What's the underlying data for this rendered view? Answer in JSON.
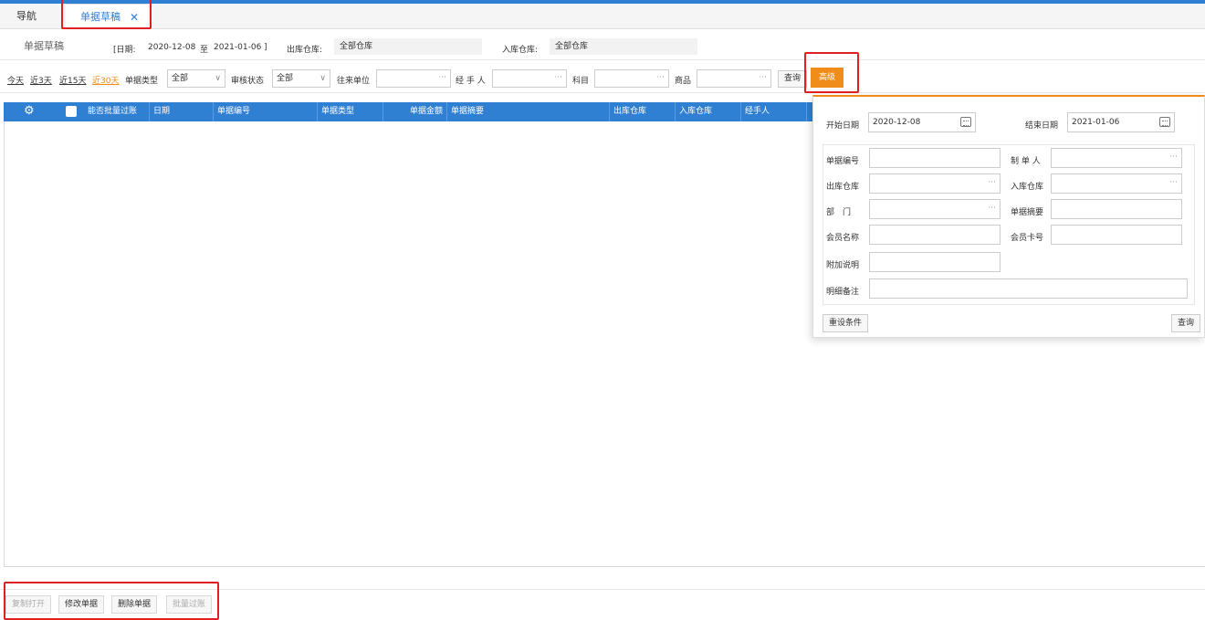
{
  "tabs": {
    "nav_label": "导航",
    "active_label": "单据草稿",
    "close_glyph": "✕"
  },
  "info": {
    "title": "单据草稿",
    "date_label": "[日期:",
    "date_from": "2020-12-08",
    "date_sep": "至",
    "date_to": "2021-01-06",
    "date_end": "]",
    "out_wh_label": "出库仓库:",
    "out_wh_value": "全部仓库",
    "in_wh_label": "入库仓库:",
    "in_wh_value": "全部仓库"
  },
  "filters": {
    "today": "今天",
    "last3": "近3天",
    "last15": "近15天",
    "last30": "近30天",
    "doc_type_label": "单据类型",
    "doc_type_value": "全部",
    "audit_label": "审核状态",
    "audit_value": "全部",
    "partner_label": "往来单位",
    "handler_label": "经 手 人",
    "subject_label": "科目",
    "product_label": "商品",
    "query_button": "查询",
    "advanced_button": "高级",
    "select_arrow": "∨",
    "dots": "···"
  },
  "grid": {
    "columns": [
      "能否批量过账",
      "日期",
      "单据编号",
      "单据类型",
      "单据金额",
      "单据摘要",
      "出库仓库",
      "入库仓库",
      "经手人"
    ],
    "gear_icon": "⚙"
  },
  "footer": {
    "copy_open": "复制打开",
    "modify": "修改单据",
    "delete": "删除单据",
    "batch_post": "批量过账"
  },
  "panel": {
    "start_label": "开始日期",
    "start_value": "2020-12-08",
    "end_label": "结束日期",
    "end_value": "2021-01-06",
    "doc_no_label": "单据编号",
    "creator_label": "制 单 人",
    "out_wh_label": "出库仓库",
    "in_wh_label": "入库仓库",
    "dept_label": "部　门",
    "summary_label": "单据摘要",
    "member_name_label": "会员名称",
    "member_card_label": "会员卡号",
    "extra_label": "附加说明",
    "detail_label": "明细备注",
    "reset_button": "重设条件",
    "query_button": "查询",
    "dots": "···"
  }
}
